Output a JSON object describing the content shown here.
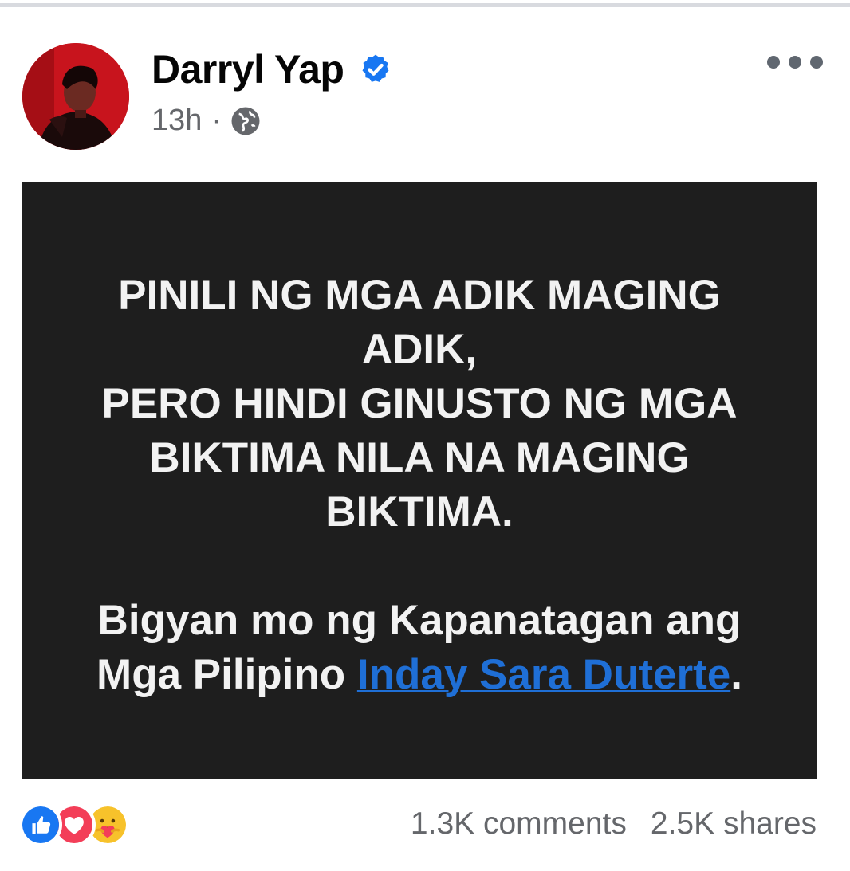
{
  "post": {
    "author": "Darryl Yap",
    "time": "13h",
    "separator": "·",
    "icons": {
      "verified": "verified-badge-icon",
      "audience": "globe-icon",
      "more": "more-options-icon"
    },
    "colors": {
      "verified": "#1877f2",
      "card_background": "#1e1e1e",
      "tag_link": "#1f6fd6"
    }
  },
  "card": {
    "lines": [
      "PINILI NG MGA ADIK MAGING",
      "ADIK,",
      "PERO HINDI GINUSTO NG MGA",
      "BIKTIMA NILA NA MAGING",
      "BIKTIMA."
    ],
    "closing_line_1": "Bigyan mo ng Kapanatagan ang",
    "closing_line_2_prefix": "Mga Pilipino ",
    "tag": "Inday Sara Duterte",
    "closing_suffix": "."
  },
  "footer": {
    "reactions": [
      "like-reaction-icon",
      "love-reaction-icon",
      "care-reaction-icon"
    ],
    "comments": "1.3K comments",
    "shares": "2.5K shares"
  }
}
